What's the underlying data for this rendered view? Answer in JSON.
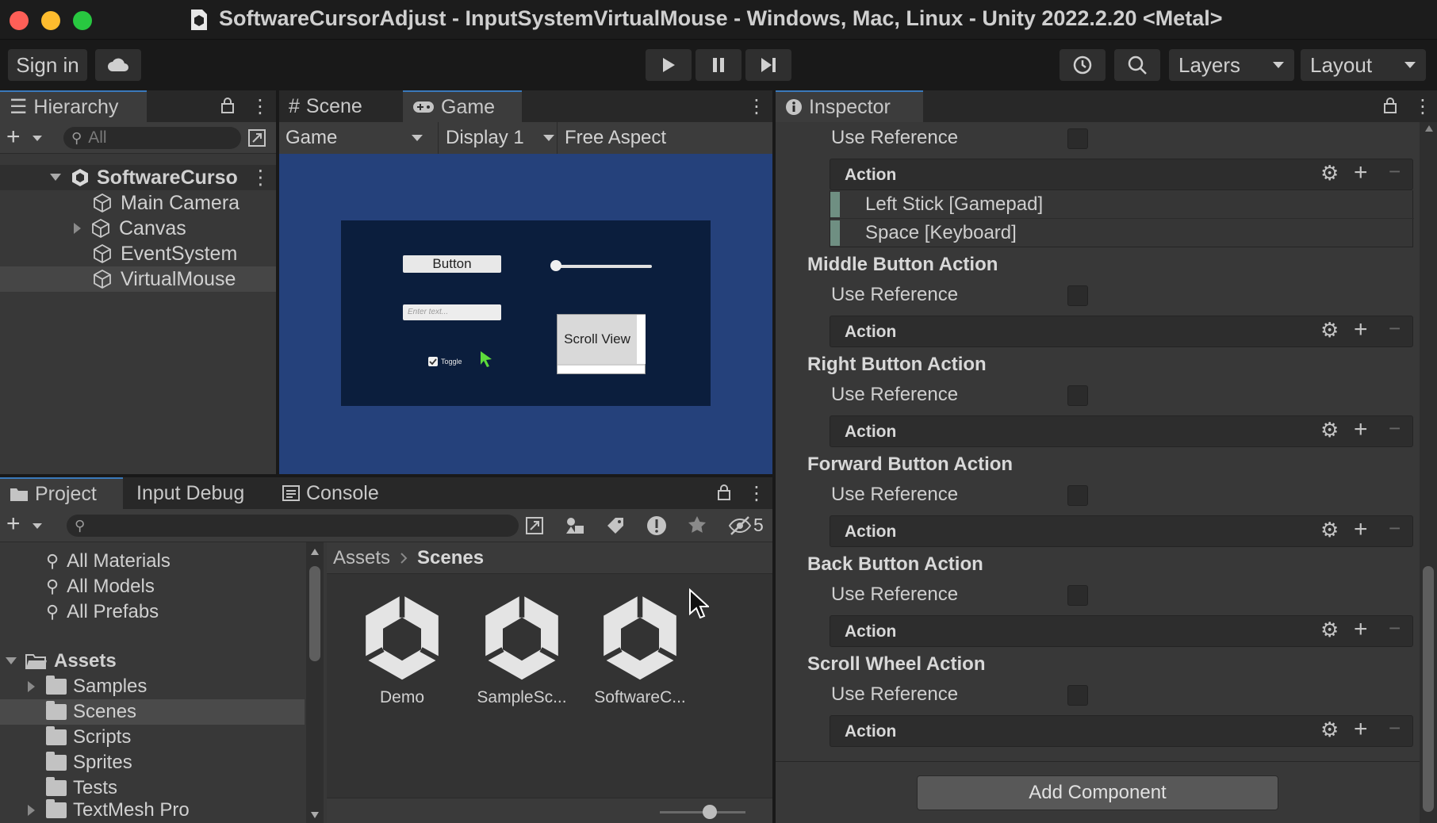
{
  "window": {
    "title": "SoftwareCursorAdjust - InputSystemVirtualMouse - Windows, Mac, Linux - Unity 2022.2.20 <Metal>",
    "traffic_colors": [
      "#fe5f57",
      "#febc2e",
      "#28c840"
    ]
  },
  "toolbar": {
    "sign_in": "Sign in",
    "layers": "Layers",
    "layout": "Layout"
  },
  "hierarchy": {
    "tab": "Hierarchy",
    "search_placeholder": "All",
    "scene_name": "SoftwareCurso",
    "items": [
      {
        "label": "Main Camera"
      },
      {
        "label": "Canvas"
      },
      {
        "label": "EventSystem"
      },
      {
        "label": "VirtualMouse"
      }
    ]
  },
  "game_view": {
    "tabs": [
      "Scene",
      "Game"
    ],
    "dropdown_game": "Game",
    "dropdown_display": "Display 1",
    "aspect": "Free Aspect",
    "ui": {
      "button": "Button",
      "input_placeholder": "Enter text...",
      "toggle": "Toggle",
      "scroll_view": "Scroll View"
    }
  },
  "bottom_tabs": {
    "project": "Project",
    "input_debug": "Input Debug",
    "console": "Console",
    "hidden_count": "5"
  },
  "project": {
    "favorites": [
      "All Materials",
      "All Models",
      "All Prefabs"
    ],
    "assets_root": "Assets",
    "folders": [
      "Samples",
      "Scenes",
      "Scripts",
      "Sprites",
      "Tests",
      "TextMesh Pro"
    ],
    "breadcrumb": [
      "Assets",
      "Scenes"
    ],
    "files": [
      "Demo",
      "SampleSc...",
      "SoftwareC..."
    ]
  },
  "inspector": {
    "tab": "Inspector",
    "use_reference": "Use Reference",
    "action_label": "Action",
    "top_bindings": [
      "Left Stick [Gamepad]",
      "Space [Keyboard]"
    ],
    "sections": [
      {
        "title": "Middle Button Action"
      },
      {
        "title": "Right Button Action"
      },
      {
        "title": "Forward Button Action"
      },
      {
        "title": "Back Button Action"
      },
      {
        "title": "Scroll Wheel Action"
      }
    ],
    "add_component": "Add Component"
  }
}
